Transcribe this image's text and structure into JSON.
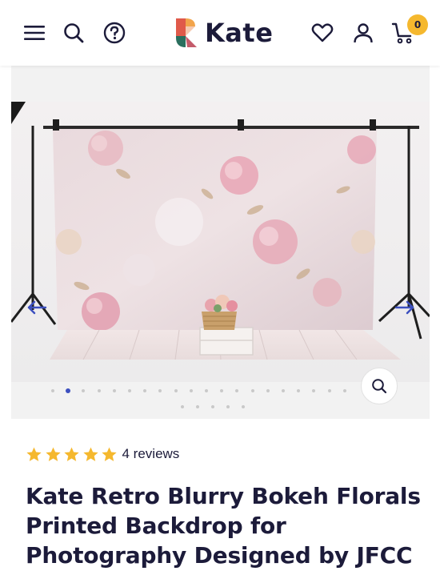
{
  "header": {
    "logo_text": "Kate",
    "cart_count": "0",
    "icons": [
      "menu-icon",
      "search-icon",
      "help-icon",
      "heart-icon",
      "user-icon",
      "cart-icon"
    ]
  },
  "gallery": {
    "image_count": 25,
    "active_index": 1,
    "icons": [
      "chevron-left-icon",
      "chevron-right-icon",
      "zoom-icon"
    ]
  },
  "product": {
    "rating": 5,
    "reviews_label": "4 reviews",
    "title": "Kate Retro Blurry Bokeh Florals Printed Backdrop for Photography Designed by JFCC"
  },
  "colors": {
    "primary_text": "#1c1b3a",
    "star": "#f5b82e",
    "badge": "#f5b82e",
    "active_dot": "#3c4fbf",
    "arrow": "#3c4fbf"
  }
}
